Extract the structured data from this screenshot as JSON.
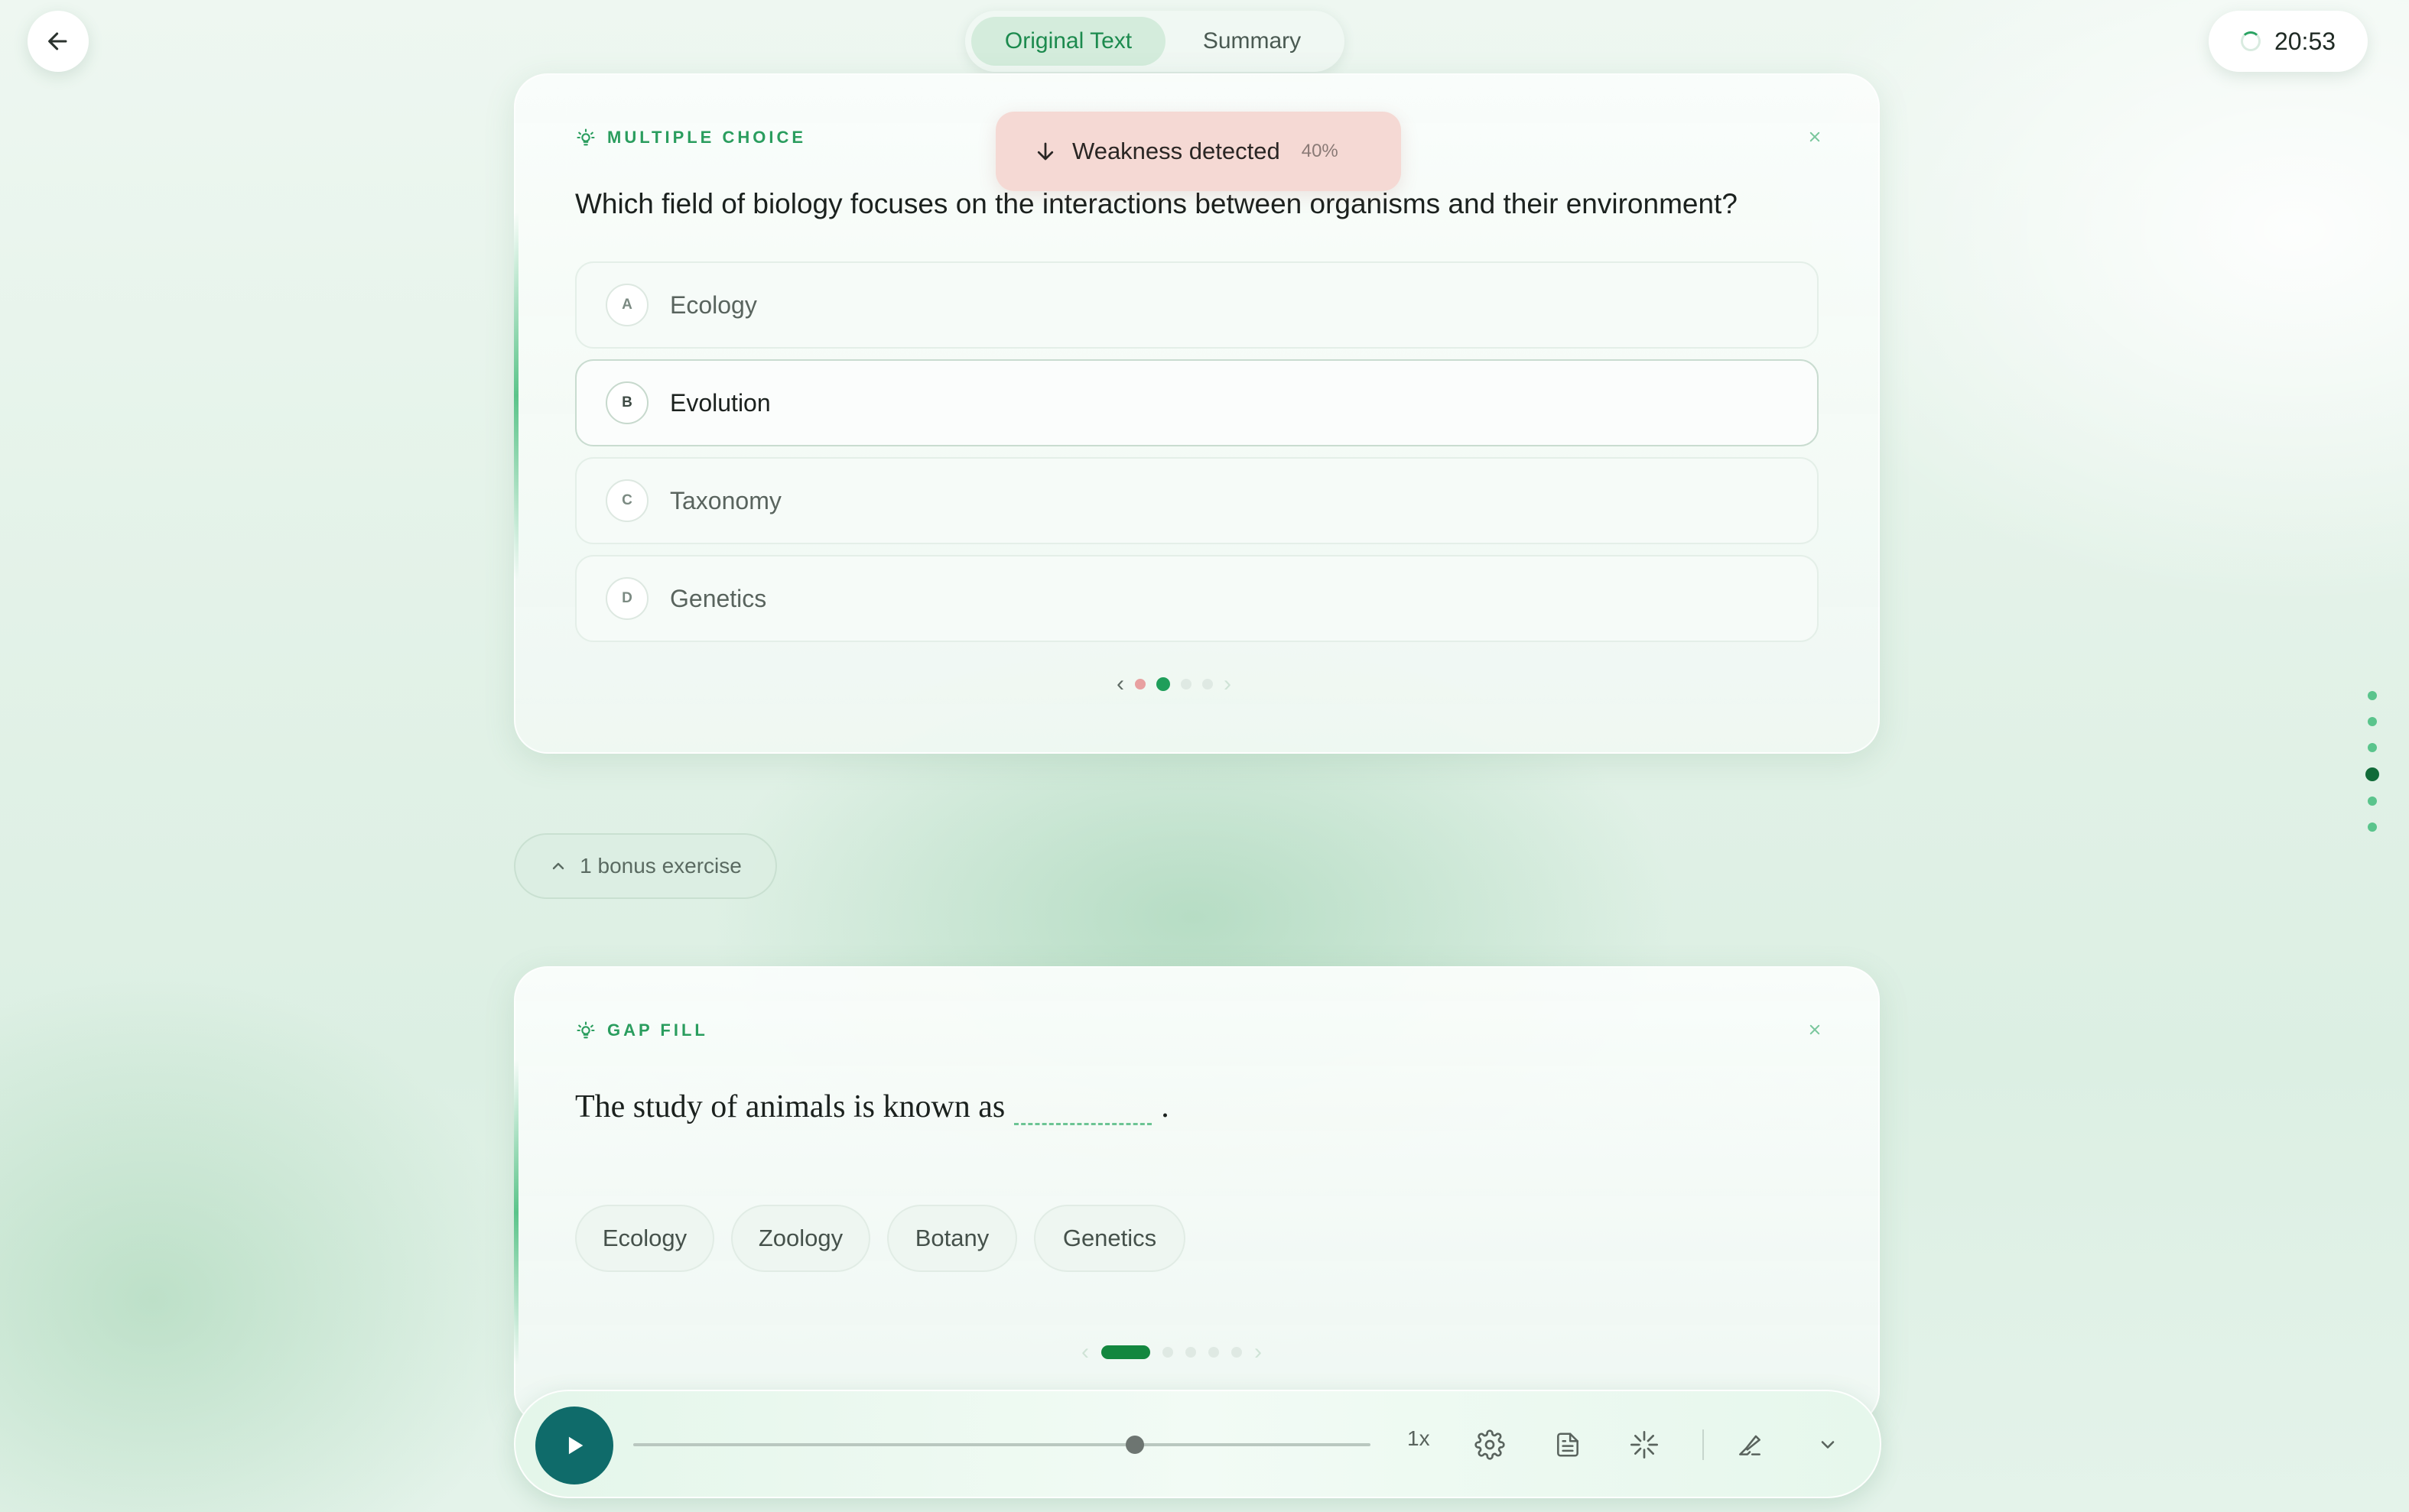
{
  "toggle": {
    "options": [
      "Original Text",
      "Summary"
    ],
    "active": "Original Text"
  },
  "timer": {
    "value": "20:53"
  },
  "toast": {
    "text": "Weakness detected",
    "percent": "40%"
  },
  "mc_card": {
    "label": "MULTIPLE CHOICE",
    "question": "Which field of biology focuses on the interactions between organisms and their environment?",
    "options": [
      {
        "letter": "A",
        "text": "Ecology",
        "selected": false
      },
      {
        "letter": "B",
        "text": "Evolution",
        "selected": true
      },
      {
        "letter": "C",
        "text": "Taxonomy",
        "selected": false
      },
      {
        "letter": "D",
        "text": "Genetics",
        "selected": false
      }
    ],
    "pager": {
      "total": 4,
      "current": 2
    }
  },
  "bonus": {
    "label": "1 bonus exercise"
  },
  "gap_card": {
    "label": "GAP FILL",
    "sentence_before": "The study of animals is known as",
    "sentence_after": ".",
    "choices": [
      "Ecology",
      "Zoology",
      "Botany",
      "Genetics"
    ],
    "pager": {
      "total": 5,
      "current": 1
    }
  },
  "player": {
    "speed": "1x",
    "progress": 0.68
  },
  "side_nav": {
    "count": 6,
    "active": 4
  },
  "colors": {
    "accent": "#1f9e5a",
    "play": "#0f6b6a",
    "toast_bg": "#f4d6d0"
  }
}
